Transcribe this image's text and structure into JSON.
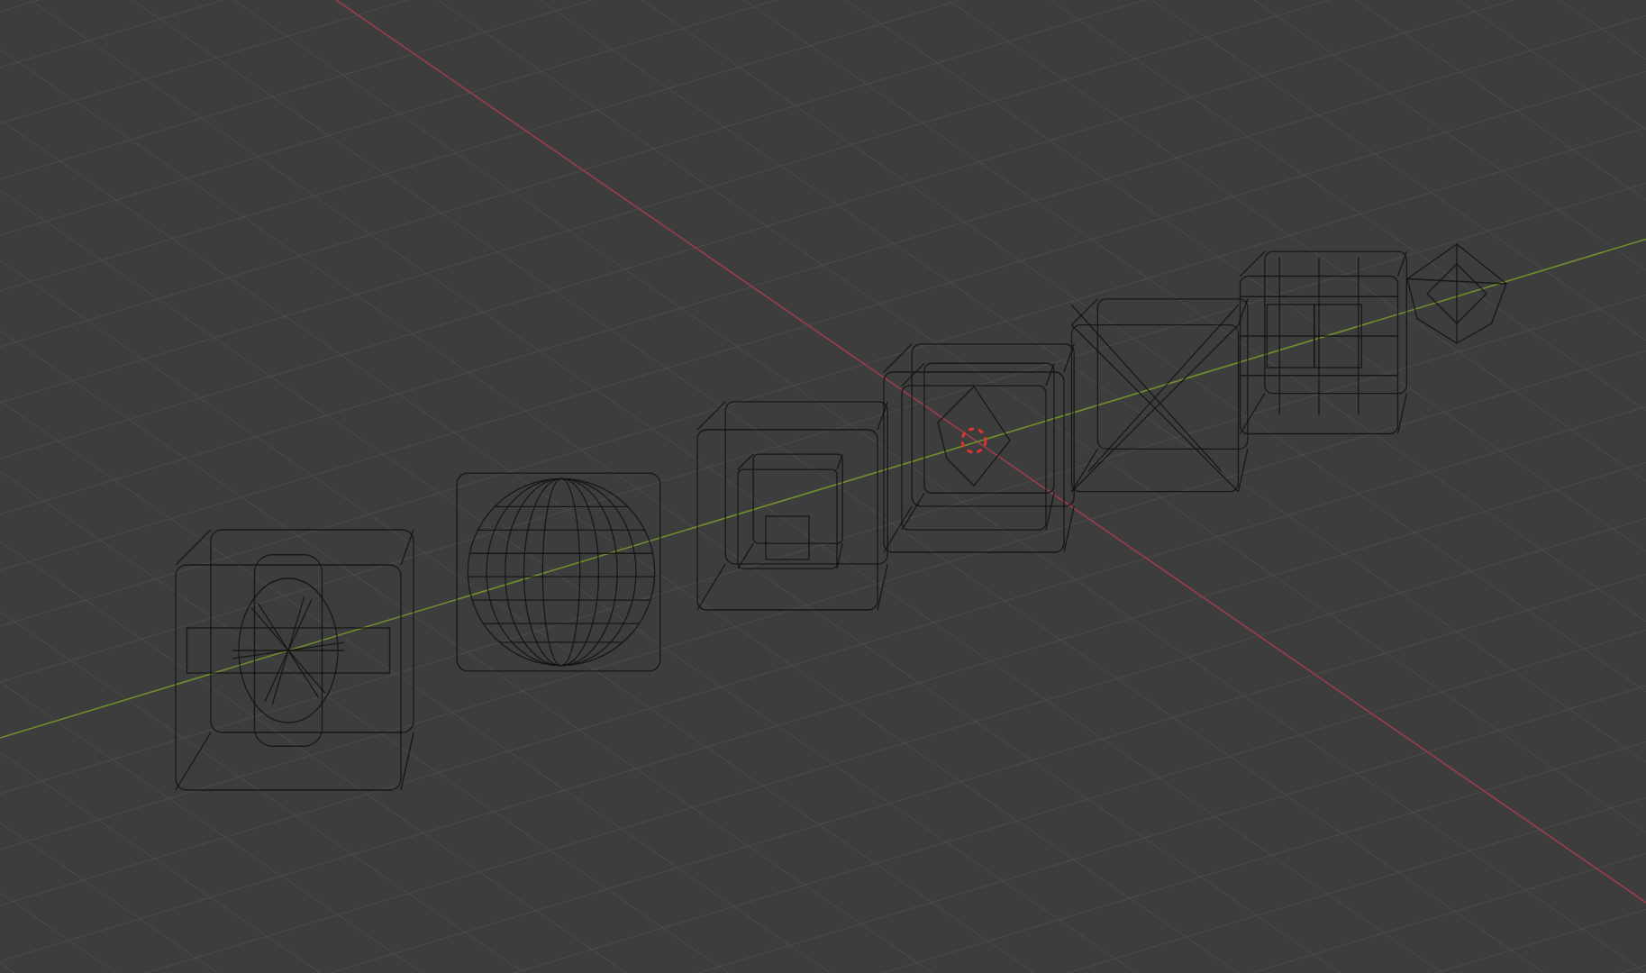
{
  "viewport": {
    "objects": [
      {
        "kind": "cross-cube"
      },
      {
        "kind": "sphere"
      },
      {
        "kind": "inset-cube"
      },
      {
        "kind": "cube"
      },
      {
        "kind": "x-cube"
      },
      {
        "kind": "grid-cube"
      },
      {
        "kind": "octahedron"
      }
    ]
  }
}
